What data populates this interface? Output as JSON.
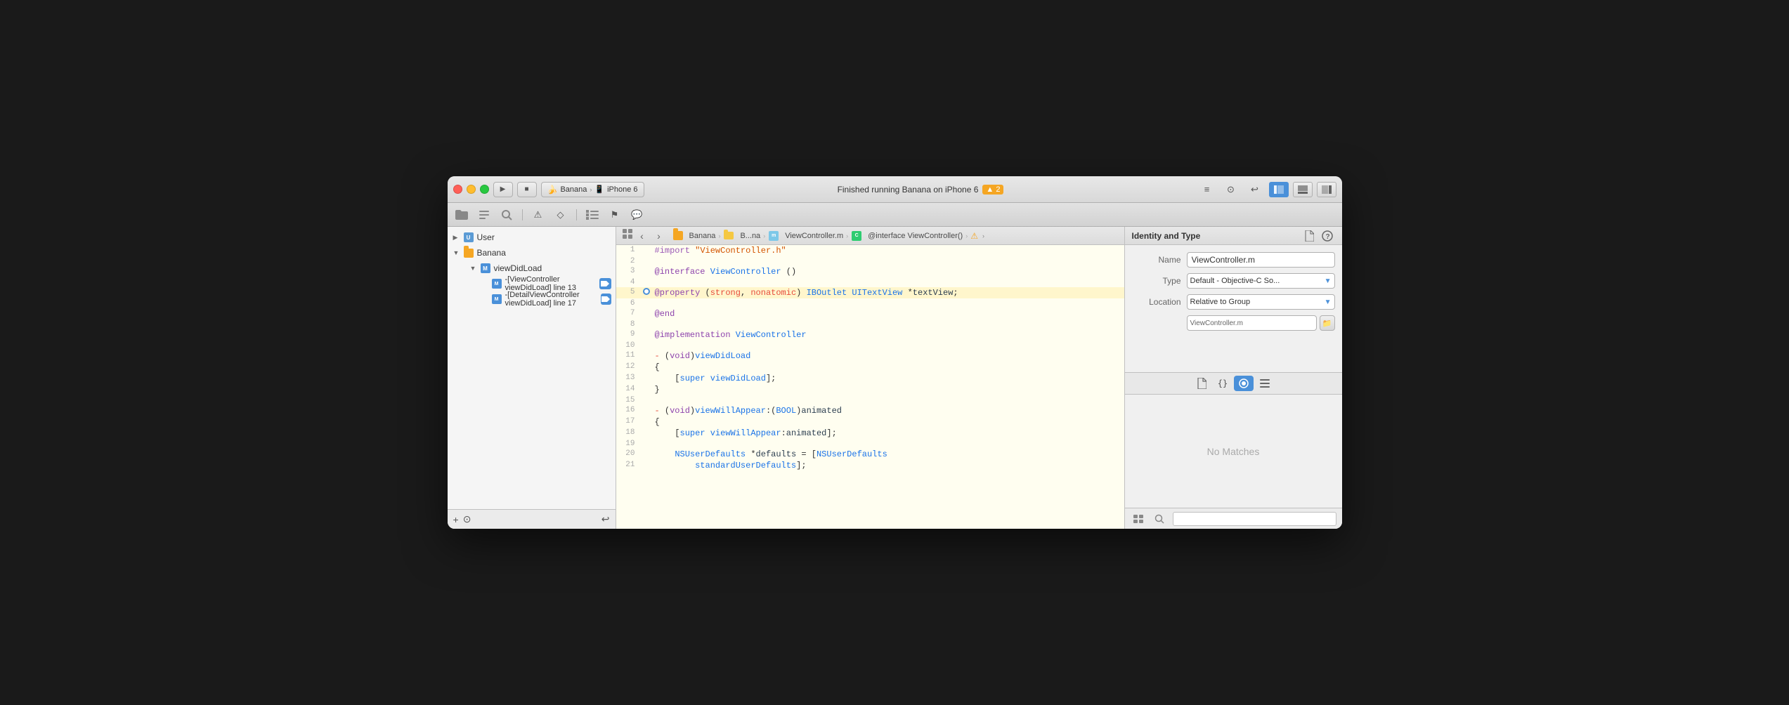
{
  "window": {
    "title": "Banana — iPhone 6"
  },
  "titlebar": {
    "scheme_label": "Banana",
    "device_label": "iPhone 6",
    "status_text": "Finished running Banana on iPhone 6",
    "warning_count": "▲ 2",
    "btn_play": "▶",
    "btn_stop": "■"
  },
  "toolbar": {
    "icons": [
      "folder",
      "symbol",
      "search",
      "warning",
      "bookmark",
      "list",
      "flag",
      "message"
    ]
  },
  "breadcrumb": {
    "items": [
      "Banana",
      "B...na",
      "ViewController.m",
      "@interface ViewController()"
    ],
    "nav_back": "‹",
    "nav_fwd": "›"
  },
  "sidebar": {
    "items": [
      {
        "level": 1,
        "label": "User",
        "type": "group",
        "arrow": "▶",
        "indent": 1
      },
      {
        "level": 1,
        "label": "Banana",
        "type": "group",
        "arrow": "▼",
        "indent": 1
      },
      {
        "level": 2,
        "label": "viewDidLoad",
        "type": "method",
        "arrow": "▼",
        "indent": 2
      },
      {
        "level": 3,
        "label": "-[ViewController viewDidLoad] line 13",
        "type": "call",
        "indent": 3,
        "badge": true
      },
      {
        "level": 3,
        "label": "-[DetailViewController viewDidLoad] line 17",
        "type": "call",
        "indent": 3,
        "badge": true
      }
    ],
    "bottom": {
      "add_btn": "+",
      "filter_btn": "⊙",
      "options_btn": "↩"
    }
  },
  "code": {
    "lines": [
      {
        "num": 1,
        "text": "#import \"ViewController.h\"",
        "type": "import"
      },
      {
        "num": 2,
        "text": "",
        "type": "empty"
      },
      {
        "num": 3,
        "text": "@interface ViewController ()",
        "type": "interface"
      },
      {
        "num": 4,
        "text": "",
        "type": "empty"
      },
      {
        "num": 5,
        "text": "@property (strong, nonatomic) IBOutlet UITextView *textView;",
        "type": "property",
        "active": true
      },
      {
        "num": 6,
        "text": "",
        "type": "empty"
      },
      {
        "num": 7,
        "text": "@end",
        "type": "end"
      },
      {
        "num": 8,
        "text": "",
        "type": "empty"
      },
      {
        "num": 9,
        "text": "@implementation ViewController",
        "type": "impl"
      },
      {
        "num": 10,
        "text": "",
        "type": "empty"
      },
      {
        "num": 11,
        "text": "- (void)viewDidLoad",
        "type": "method"
      },
      {
        "num": 12,
        "text": "{",
        "type": "brace"
      },
      {
        "num": 13,
        "text": "    [super viewDidLoad];",
        "type": "super"
      },
      {
        "num": 14,
        "text": "}",
        "type": "brace"
      },
      {
        "num": 15,
        "text": "",
        "type": "empty"
      },
      {
        "num": 16,
        "text": "- (void)viewWillAppear:(BOOL)animated",
        "type": "method2"
      },
      {
        "num": 17,
        "text": "{",
        "type": "brace"
      },
      {
        "num": 18,
        "text": "    [super viewWillAppear:animated];",
        "type": "super"
      },
      {
        "num": 19,
        "text": "",
        "type": "empty"
      },
      {
        "num": 20,
        "text": "    NSUserDefaults *defaults = [NSUserDefaults",
        "type": "ns"
      },
      {
        "num": 21,
        "text": "        standardUserDefaults];",
        "type": "ns2"
      }
    ]
  },
  "inspector": {
    "title": "Identity and Type",
    "fields": {
      "name_label": "Name",
      "name_value": "ViewController.m",
      "type_label": "Type",
      "type_value": "Default - Objective-C So...",
      "location_label": "Location",
      "location_value": "Relative to Group"
    },
    "tabs": [
      {
        "id": "file",
        "icon": "☐",
        "active": false
      },
      {
        "id": "braces",
        "icon": "{}",
        "active": false
      },
      {
        "id": "circle",
        "icon": "◉",
        "active": true
      },
      {
        "id": "list",
        "icon": "≡",
        "active": false
      }
    ],
    "no_matches": "No Matches",
    "bottom": {
      "grid_btn": "⊞",
      "search_btn": "⊙"
    }
  }
}
